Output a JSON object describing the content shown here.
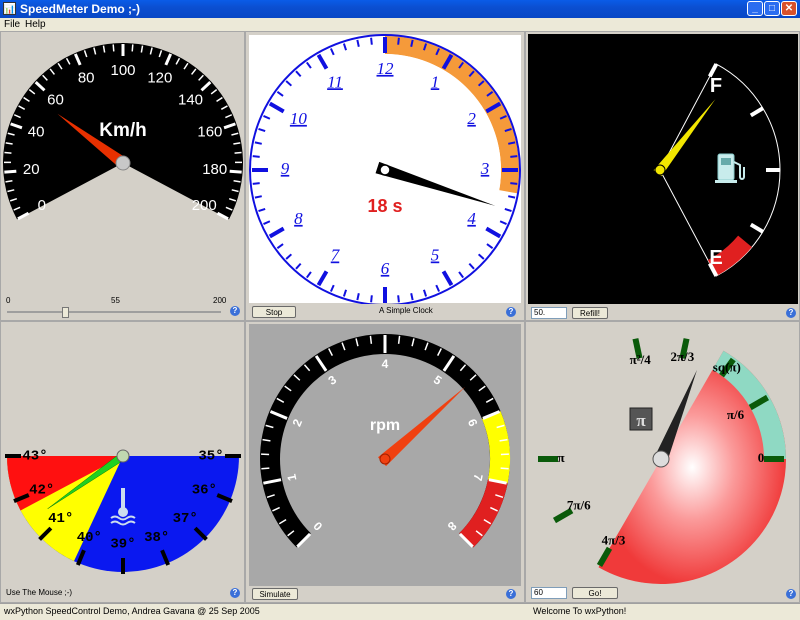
{
  "window": {
    "title": "SpeedMeter Demo ;-)",
    "icon_glyph": "📊",
    "minimize_glyph": "_",
    "maximize_glyph": "□",
    "close_glyph": "✕"
  },
  "menu": {
    "file": "File",
    "help": "Help"
  },
  "help_glyph": "?",
  "speed": {
    "unit": "Km/h",
    "ticks": [
      "0",
      "20",
      "40",
      "60",
      "80",
      "100",
      "120",
      "140",
      "160",
      "180",
      "200"
    ],
    "slider_min": "0",
    "slider_value": "55",
    "slider_max": "200",
    "value": 55
  },
  "clock": {
    "hours": [
      "12",
      "1",
      "2",
      "3",
      "4",
      "5",
      "6",
      "7",
      "8",
      "9",
      "10",
      "11"
    ],
    "seconds_text": "18 s",
    "stop_label": "Stop",
    "caption": "A Simple Clock",
    "seconds": 18
  },
  "fuel": {
    "full": "F",
    "empty": "E",
    "icon": "fuel-pump-icon",
    "level_value": "50.",
    "refill_label": "Refill!"
  },
  "temperature": {
    "ticks": [
      "35°",
      "36°",
      "37°",
      "38°",
      "39°",
      "40°",
      "41°",
      "42°",
      "43°"
    ],
    "caption": "Use The Mouse ;-)",
    "icon": "thermometer-icon"
  },
  "rpm": {
    "unit": "rpm",
    "ticks": [
      "0",
      "1",
      "2",
      "3",
      "4",
      "5",
      "6",
      "7",
      "8"
    ],
    "simulate_label": "Simulate"
  },
  "pi_meter": {
    "labels": [
      "0",
      "π/6",
      "sq(π)",
      "2π/3",
      "π²/4",
      "π",
      "7π/6",
      "4π/3"
    ],
    "center_glyph": "π",
    "input_value": "60",
    "go_label": "Go!"
  },
  "status": {
    "left": "wxPython SpeedControl Demo, Andrea Gavana @ 25 Sep 2005",
    "right": "Welcome To wxPython!"
  },
  "colors": {
    "accent_red": "#e83000",
    "clock_blue": "#1010e0",
    "clock_orange": "#f59a3a",
    "pi_red": "#f03a3a",
    "pi_mint": "#8fd9c3"
  }
}
